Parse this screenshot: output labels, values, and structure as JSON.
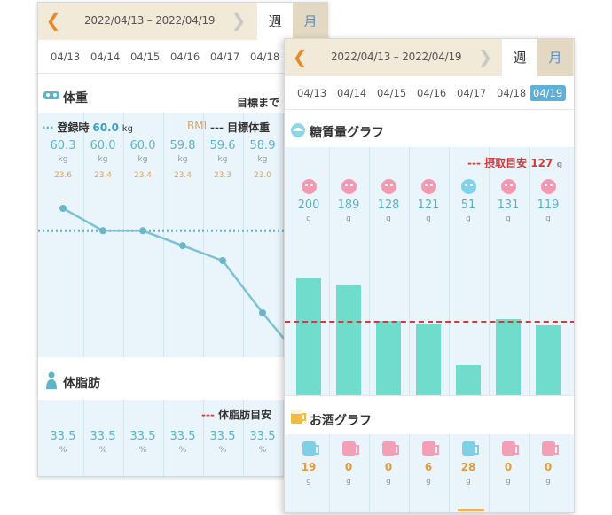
{
  "back_screen": {
    "header": {
      "range": "2022/04/13 – 2022/04/19",
      "week_tab": "週",
      "month_tab": "月"
    },
    "dates": [
      "04/13",
      "04/14",
      "04/15",
      "04/16",
      "04/17",
      "04/18"
    ],
    "weight_section": {
      "title": "体重",
      "goal_label": "目標まで",
      "legend_registered": "登録時",
      "registered_value": "60.0",
      "registered_unit": "kg",
      "legend_bmi": "BMI",
      "legend_target": "--- 目標体重",
      "values": [
        "60.3",
        "60.0",
        "60.0",
        "59.8",
        "59.6",
        "58.9"
      ],
      "unit": "kg",
      "bmi_values": [
        "23.6",
        "23.4",
        "23.4",
        "23.4",
        "23.3",
        "23.0"
      ]
    },
    "bodyfat_section": {
      "title": "体脂肪",
      "legend_target": "--- 体脂肪目安",
      "values": [
        "33.5",
        "33.5",
        "33.5",
        "33.5",
        "33.5",
        "33.5"
      ],
      "unit": "%"
    }
  },
  "front_screen": {
    "header": {
      "range": "2022/04/13 – 2022/04/19",
      "week_tab": "週",
      "month_tab": "月"
    },
    "dates": [
      "04/13",
      "04/14",
      "04/15",
      "04/16",
      "04/17",
      "04/18",
      "04/19"
    ],
    "selected_date": "04/19",
    "carb_section": {
      "title": "糖質量グラフ",
      "legend_label": "--- 摂取目安",
      "legend_value": "127",
      "legend_unit": "g",
      "values": [
        "200",
        "189",
        "128",
        "121",
        "51",
        "131",
        "119"
      ],
      "unit": "g",
      "faces": [
        "pink",
        "pink",
        "pink",
        "pink",
        "blue",
        "pink",
        "pink"
      ]
    },
    "alcohol_section": {
      "title": "お酒グラフ",
      "values": [
        "19",
        "0",
        "0",
        "6",
        "28",
        "0",
        "0"
      ],
      "unit": "g",
      "mugs": [
        "blue",
        "pink",
        "pink",
        "pink",
        "blue",
        "pink",
        "pink"
      ]
    }
  },
  "chart_data": [
    {
      "type": "line",
      "categories": [
        "04/13",
        "04/14",
        "04/15",
        "04/16",
        "04/17",
        "04/18"
      ],
      "series": [
        {
          "values": [
            60.3,
            60.0,
            60.0,
            59.8,
            59.6,
            58.9
          ]
        }
      ],
      "reference": {
        "label": "登録時",
        "value": 60.0
      }
    },
    {
      "type": "bar",
      "categories": [
        "04/13",
        "04/14",
        "04/15",
        "04/16",
        "04/17",
        "04/18",
        "04/19"
      ],
      "values": [
        200,
        189,
        128,
        121,
        51,
        131,
        119
      ],
      "reference": {
        "label": "摂取目安",
        "value": 127
      }
    }
  ],
  "colors": {
    "accent": "#5fb3c8",
    "bar": "#6fdccc",
    "target_line": "#d23b3b",
    "header_bg": "#f2ead8",
    "plot_bg": "#eaf5fb"
  }
}
